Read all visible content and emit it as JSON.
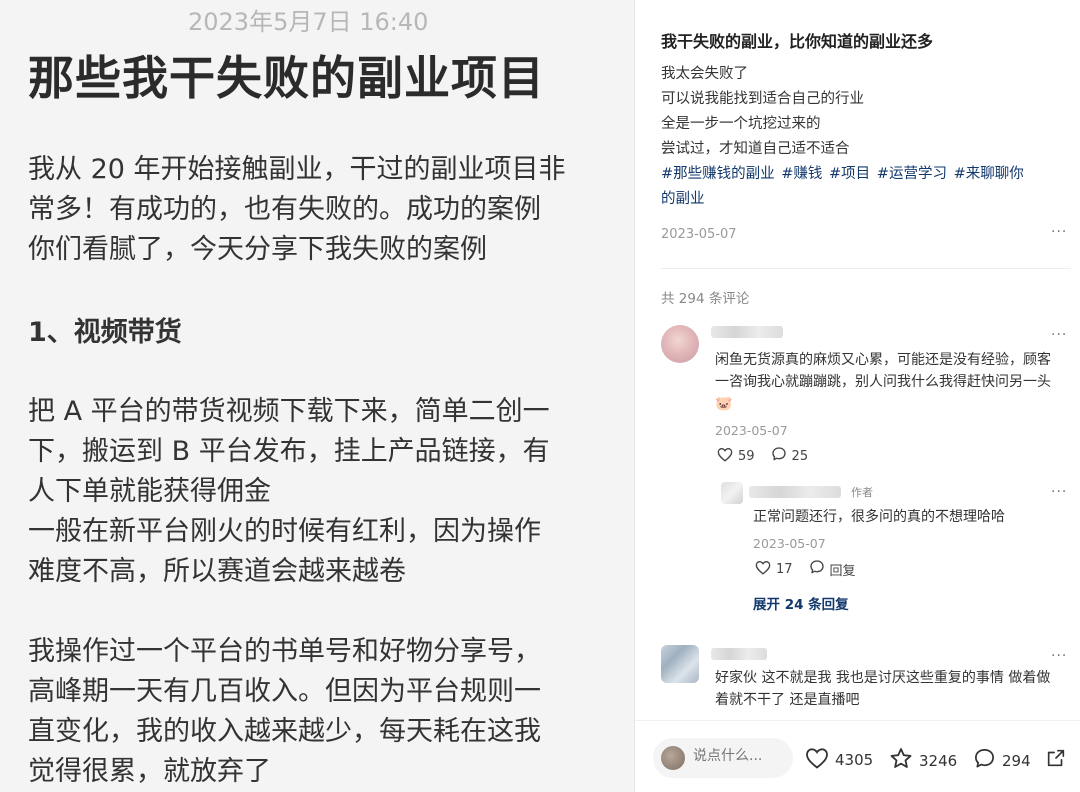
{
  "post_image": {
    "date": "2023年5月7日 16:40",
    "title": "那些我干失败的副业项目",
    "intro_lines": [
      "我从 20 年开始接触副业，干过的副业项目非",
      "常多！有成功的，也有失败的。成功的案例",
      "你们看腻了，今天分享下我失败的案例"
    ],
    "section_heading": "1、视频带货",
    "para1_lines": [
      "把 A 平台的带货视频下载下来，简单二创一",
      "下，搬运到 B 平台发布，挂上产品链接，有",
      "人下单就能获得佣金",
      "一般在新平台刚火的时候有红利，因为操作",
      "难度不高，所以赛道会越来越卷"
    ],
    "para2_lines": [
      "我操作过一个平台的书单号和好物分享号，",
      "高峰期一天有几百收入。但因为平台规则一",
      "直变化，我的收入越来越少，每天耗在这我",
      "觉得很累，就放弃了"
    ]
  },
  "note": {
    "title": "我干失败的副业，比你知道的副业还多",
    "body_lines": [
      "我太会失败了",
      "可以说我能找到适合自己的行业",
      "全是一步一个坑挖过来的",
      "尝试过，才知道自己适不适合"
    ],
    "tags": [
      "#那些赚钱的副业",
      "#赚钱",
      "#项目",
      "#运营学习",
      "#来聊聊你"
    ],
    "tags_line2": "的副业",
    "date": "2023-05-07",
    "more": "···"
  },
  "comments": {
    "count_label": "共 294 条评论",
    "c1": {
      "lines": [
        "闲鱼无货源真的麻烦又心累，可能还是没有经验，顾客",
        "一咨询我心就蹦蹦跳，别人问我什么我得赶快问另一头"
      ],
      "emoji": "🐷",
      "date": "2023-05-07",
      "likes": "59",
      "replies": "25"
    },
    "r1": {
      "author_tag": "作者",
      "text": "正常问题还行，很多问的真的不想理哈哈",
      "date": "2023-05-07",
      "likes": "17",
      "reply_label": "回复"
    },
    "expand_label": "展开 24 条回复",
    "c2": {
      "lines": [
        "好家伙 这不就是我 我也是讨厌这些重复的事情 做着做",
        "着就不干了 还是直播吧"
      ]
    }
  },
  "bottom_bar": {
    "input_placeholder": "说点什么...",
    "likes": "4305",
    "stars": "3246",
    "comments": "294"
  },
  "colors": {
    "link": "#13386c",
    "muted": "#999999"
  }
}
